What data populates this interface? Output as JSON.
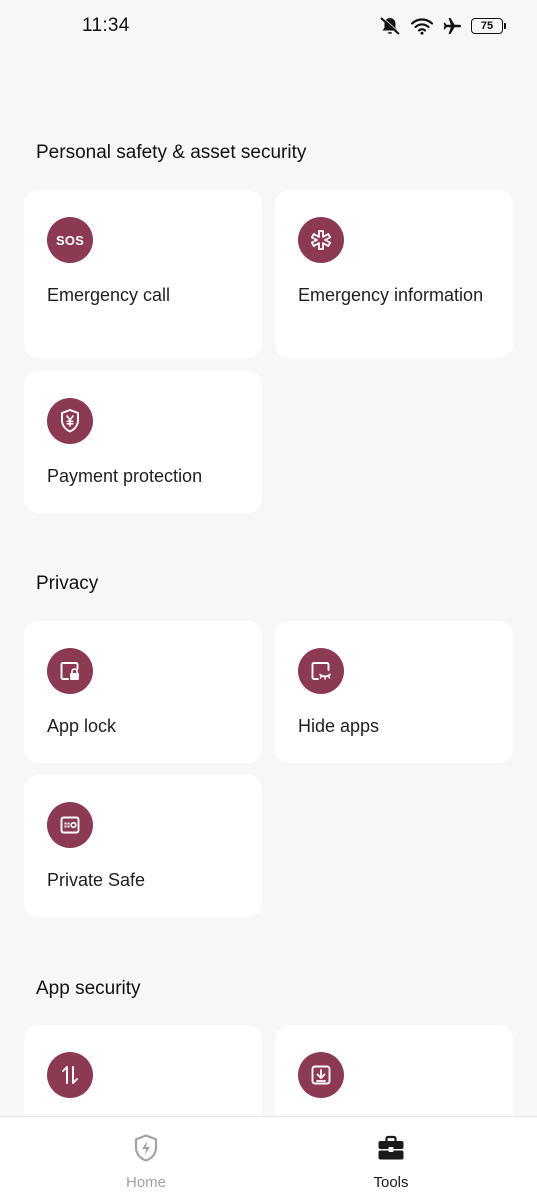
{
  "status_bar": {
    "time": "11:34",
    "battery": "75",
    "icons": [
      "mute-bell-icon",
      "wifi-icon",
      "airplane-icon",
      "battery-icon"
    ]
  },
  "sections": [
    {
      "title": "Personal safety & asset security",
      "cards": [
        {
          "label": "Emergency call",
          "icon": "sos-icon",
          "icon_text": "SOS"
        },
        {
          "label": "Emergency information",
          "icon": "medical-star-icon"
        },
        {
          "label": "Payment protection",
          "icon": "yen-shield-icon"
        }
      ]
    },
    {
      "title": "Privacy",
      "cards": [
        {
          "label": "App lock",
          "icon": "app-lock-icon"
        },
        {
          "label": "Hide apps",
          "icon": "hide-apps-icon"
        },
        {
          "label": "Private Safe",
          "icon": "safe-icon"
        }
      ]
    },
    {
      "title": "App security",
      "cards": [
        {
          "label": "",
          "icon": "transfer-arrows-icon"
        },
        {
          "label": "",
          "icon": "download-box-icon"
        }
      ]
    }
  ],
  "bottom_nav": {
    "items": [
      {
        "label": "Home",
        "icon": "shield-bolt-icon",
        "active": false
      },
      {
        "label": "Tools",
        "icon": "toolbox-icon",
        "active": true
      }
    ]
  },
  "colors": {
    "accent": "#8b3a52",
    "background": "#f7f7f7",
    "card": "#ffffff",
    "inactive_nav": "#a3a3a3"
  }
}
